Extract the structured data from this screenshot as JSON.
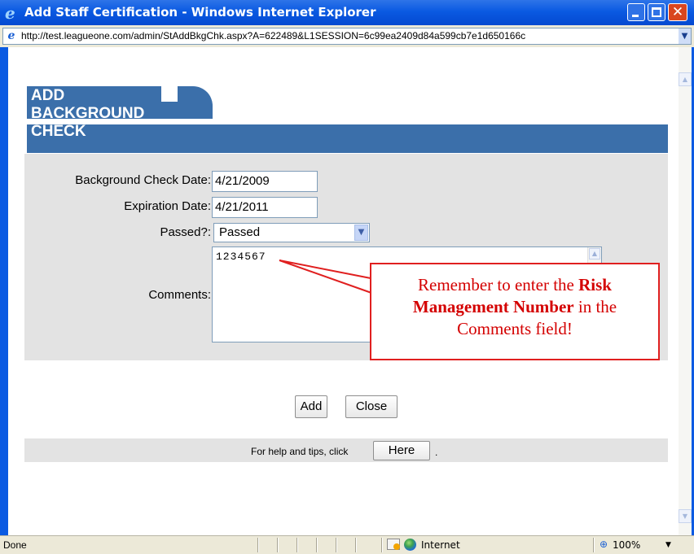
{
  "window": {
    "title": "Add Staff Certification - Windows Internet Explorer",
    "url": "http://test.leagueone.com/admin/StAddBkgChk.aspx?A=622489&L1SESSION=6c99ea2409d84a599cb7e1d650166c"
  },
  "page": {
    "header_title": "ADD BACKGROUND CHECK",
    "form": {
      "bg_check_date_label": "Background Check Date:",
      "bg_check_date_value": "4/21/2009",
      "expiration_date_label": "Expiration Date:",
      "expiration_date_value": "4/21/2011",
      "passed_label": "Passed?:",
      "passed_value": "Passed",
      "comments_label": "Comments:",
      "comments_value": "1234567"
    },
    "callout": {
      "text_before": "Remember to enter the ",
      "text_bold": "Risk Management Number",
      "text_after": " in the Comments field!"
    },
    "buttons": {
      "add_label": "Add",
      "close_label": "Close"
    },
    "help": {
      "text": "For help and tips, click",
      "button_label": "Here",
      "suffix": "."
    }
  },
  "statusbar": {
    "status": "Done",
    "zone": "Internet",
    "zoom": "100%"
  },
  "colors": {
    "header_blue": "#3b6faa",
    "callout_red": "#d40000",
    "panel_gray": "#e3e3e3"
  }
}
